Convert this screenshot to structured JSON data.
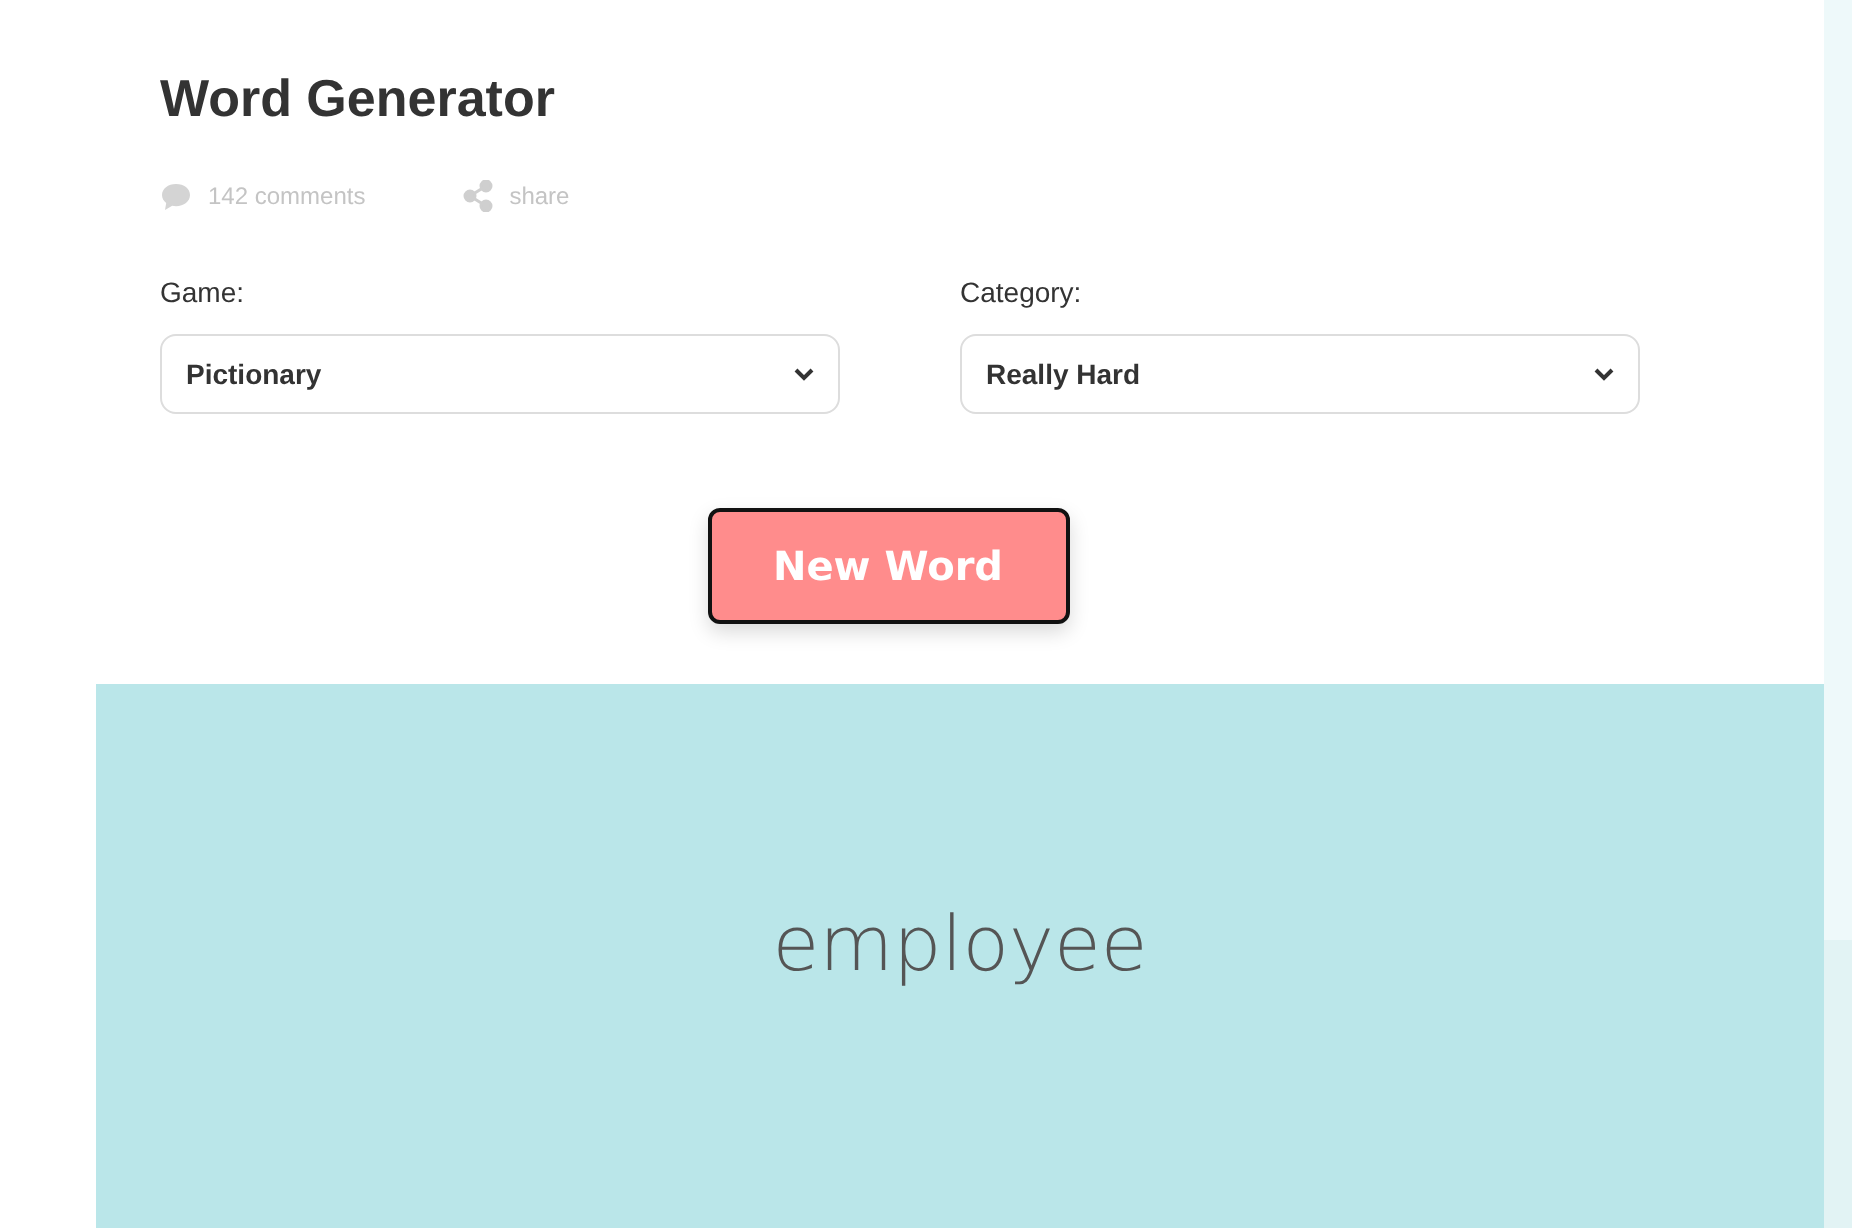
{
  "title": "Word Generator",
  "meta": {
    "comments": "142 comments",
    "share": "share"
  },
  "fields": [
    {
      "label": "Game:",
      "value": "Pictionary"
    },
    {
      "label": "Category:",
      "value": "Really Hard"
    }
  ],
  "button": "New Word",
  "word": "employee"
}
